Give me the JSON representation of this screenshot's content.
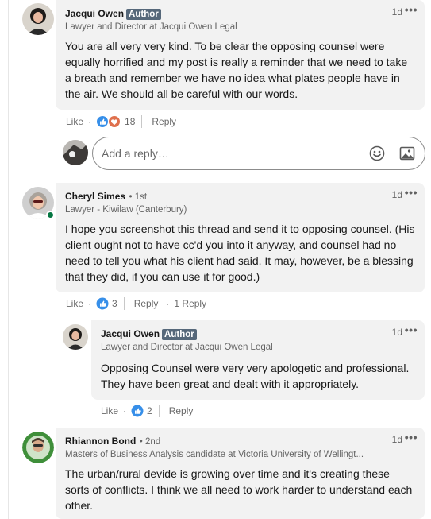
{
  "comments": [
    {
      "author": "Jacqui Owen",
      "badge": "Author",
      "headline": "Lawyer and Director at Jacqui Owen Legal",
      "time": "1d",
      "menu": "•••",
      "body": "You are all very very kind. To be clear the opposing counsel were equally horrified and my post is really a reminder that we need to take a breath and remember we have no idea what plates people have in the air. We should all be careful with our words.",
      "actions": {
        "like": "Like",
        "dot": "·",
        "reaction_count": "18",
        "reply": "Reply"
      }
    },
    {
      "author": "Cheryl Simes",
      "degree": "• 1st",
      "headline": "Lawyer - Kiwilaw (Canterbury)",
      "time": "1d",
      "menu": "•••",
      "body": "I hope you screenshot this thread and send it to opposing counsel. (His client ought not to have cc'd you into it anyway, and counsel had no need to tell you what his client had said. It may, however, be a blessing that they did, if you can use it for good.)",
      "actions": {
        "like": "Like",
        "dot": "·",
        "reaction_count": "3",
        "reply": "Reply",
        "dot2": "·",
        "replies": "1 Reply"
      }
    },
    {
      "author": "Jacqui Owen",
      "badge": "Author",
      "headline": "Lawyer and Director at Jacqui Owen Legal",
      "time": "1d",
      "menu": "•••",
      "body": "Opposing Counsel were very very apologetic and professional. They have been great and dealt with it appropriately.",
      "actions": {
        "like": "Like",
        "dot": "·",
        "reaction_count": "2",
        "reply": "Reply"
      }
    },
    {
      "author": "Rhiannon Bond",
      "degree": "• 2nd",
      "headline": "Masters of Business Analysis candidate at Victoria University of Wellingt...",
      "time": "1d",
      "menu": "•••",
      "body": "The urban/rural devide is growing over time and it's creating these sorts of conflicts. I think we all need to work harder to understand each other."
    }
  ],
  "reply_box": {
    "placeholder": "Add a reply…",
    "emoji_icon": "emoji-icon",
    "image_icon": "image-icon"
  },
  "icons": {
    "like": "like-reaction-icon",
    "love": "love-reaction-icon"
  },
  "colors": {
    "like": "#378fe9",
    "love": "#df704d",
    "online": "#057642",
    "bubble": "#f2f2f2",
    "badge": "#56687a"
  }
}
